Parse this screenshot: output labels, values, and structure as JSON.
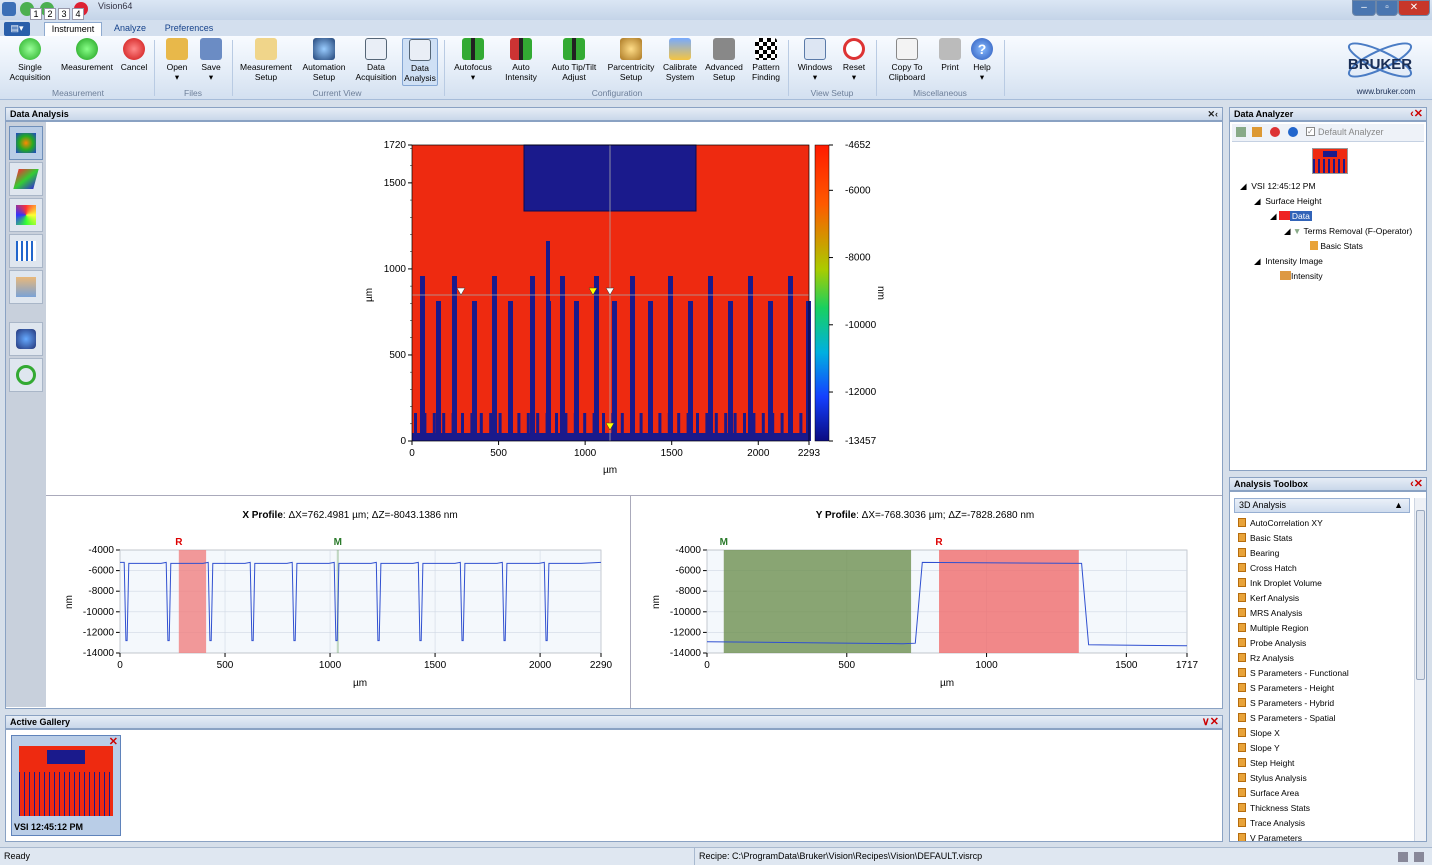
{
  "window": {
    "title": "Vision64",
    "num_tabs": [
      "1",
      "2",
      "3",
      "4"
    ]
  },
  "ribbon_tabs": [
    "Instrument",
    "Analyze",
    "Preferences"
  ],
  "ribbon": {
    "buttons": [
      {
        "label": "Single\nAcquisition",
        "icon": "green-target-icon"
      },
      {
        "label": "Measurement",
        "icon": "play-icon"
      },
      {
        "label": "Cancel",
        "icon": "cancel-icon"
      },
      {
        "label": "Open",
        "icon": "open-folder-icon"
      },
      {
        "label": "Save",
        "icon": "save-icon"
      },
      {
        "label": "Measurement\nSetup",
        "icon": "measurement-setup-icon"
      },
      {
        "label": "Automation\nSetup",
        "icon": "automation-icon"
      },
      {
        "label": "Data\nAcquisition",
        "icon": "data-acquisition-icon"
      },
      {
        "label": "Data\nAnalysis",
        "icon": "data-analysis-icon"
      },
      {
        "label": "Autofocus",
        "icon": "autofocus-icon"
      },
      {
        "label": "Auto\nIntensity",
        "icon": "auto-intensity-icon"
      },
      {
        "label": "Auto Tip/Tilt\nAdjust",
        "icon": "tip-tilt-icon"
      },
      {
        "label": "Parcentricity\nSetup",
        "icon": "parcentricity-icon"
      },
      {
        "label": "Calibrate\nSystem",
        "icon": "calibrate-icon"
      },
      {
        "label": "Advanced\nSetup",
        "icon": "advanced-setup-icon"
      },
      {
        "label": "Pattern\nFinding",
        "icon": "pattern-icon"
      },
      {
        "label": "Windows",
        "icon": "windows-icon"
      },
      {
        "label": "Reset",
        "icon": "reset-icon"
      },
      {
        "label": "Copy To\nClipboard",
        "icon": "clipboard-icon"
      },
      {
        "label": "Print",
        "icon": "print-icon"
      },
      {
        "label": "Help",
        "icon": "help-icon"
      }
    ],
    "groups": [
      "Measurement",
      "Files",
      "Current View",
      "Configuration",
      "View Setup",
      "Miscellaneous"
    ]
  },
  "brand": {
    "name": "BRUKER",
    "url": "www.bruker.com"
  },
  "data_analysis": {
    "title": "Data Analysis"
  },
  "surface_map": {
    "y_ticks": [
      "1720",
      "1500",
      "1000",
      "500",
      "0"
    ],
    "x_ticks": [
      "0",
      "500",
      "1000",
      "1500",
      "2000",
      "2293"
    ],
    "x_label": "µm",
    "y_label": "µm",
    "colorbar_ticks": [
      "-4652",
      "-6000",
      "-8000",
      "-10000",
      "-12000",
      "-13457"
    ],
    "colorbar_label": "nm"
  },
  "x_profile": {
    "title": "X Profile",
    "stats": ": ΔX=762.4981 µm; ΔZ=-8043.1386 nm",
    "marker_r": "R",
    "marker_m": "M",
    "y_ticks": [
      "-4000",
      "-6000",
      "-8000",
      "-10000",
      "-12000",
      "-14000"
    ],
    "x_ticks": [
      "0",
      "500",
      "1000",
      "1500",
      "2000",
      "2290"
    ],
    "x_label": "µm",
    "y_label": "nm"
  },
  "y_profile": {
    "title": "Y Profile",
    "stats": ": ΔX=-768.3036 µm; ΔZ=-7828.2680 nm",
    "marker_r": "R",
    "marker_m": "M",
    "y_ticks": [
      "-4000",
      "-6000",
      "-8000",
      "-10000",
      "-12000",
      "-14000"
    ],
    "x_ticks": [
      "0",
      "500",
      "1000",
      "1500",
      "1717"
    ],
    "x_label": "µm",
    "y_label": "nm"
  },
  "data_analyzer": {
    "title": "Data Analyzer",
    "default_label": "Default Analyzer",
    "tree": [
      "VSI 12:45:12 PM",
      "Surface Height",
      "Data",
      "Terms Removal (F-Operator)",
      "Basic Stats",
      "Intensity Image",
      "Intensity"
    ]
  },
  "analysis_toolbox": {
    "title": "Analysis Toolbox",
    "section": "3D Analysis",
    "items": [
      "AutoCorrelation XY",
      "Basic Stats",
      "Bearing",
      "Cross Hatch",
      "Ink Droplet Volume",
      "Kerf Analysis",
      "MRS Analysis",
      "Multiple Region",
      "Probe Analysis",
      "Rz Analysis",
      "S Parameters - Functional",
      "S Parameters - Height",
      "S Parameters - Hybrid",
      "S Parameters - Spatial",
      "Slope X",
      "Slope Y",
      "Step Height",
      "Stylus Analysis",
      "Surface Area",
      "Thickness Stats",
      "Trace Analysis",
      "V Parameters"
    ]
  },
  "gallery": {
    "title": "Active Gallery",
    "item_label": "VSI 12:45:12 PM"
  },
  "status": {
    "left": "Ready",
    "recipe": "Recipe: C:\\ProgramData\\Bruker\\Vision\\Recipes\\Vision\\DEFAULT.visrcp"
  }
}
